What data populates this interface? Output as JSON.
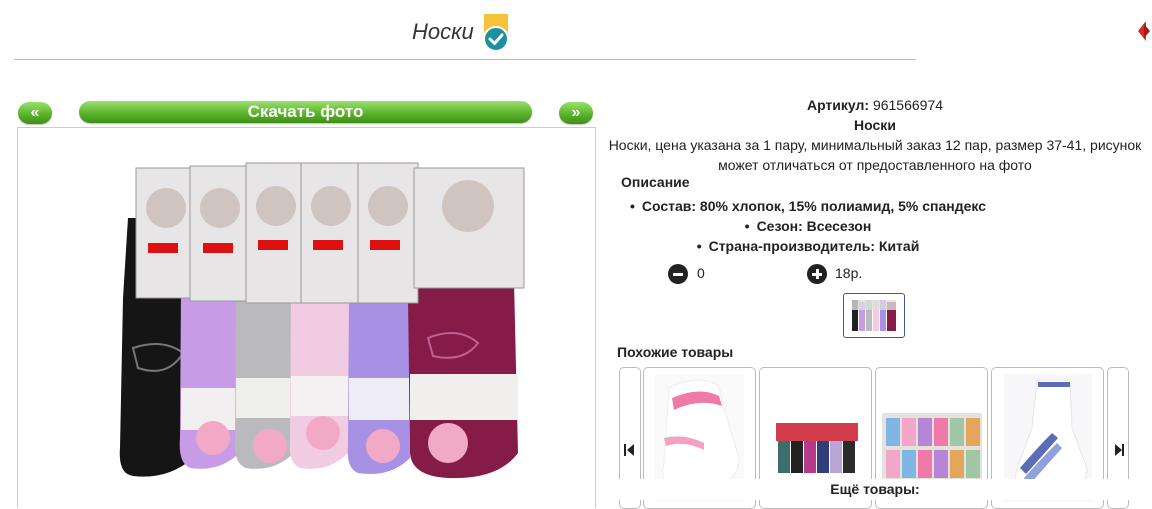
{
  "header": {
    "title": "Носки"
  },
  "gallery": {
    "prev_label": "«",
    "next_label": "»",
    "download_label": "Скачать фото"
  },
  "product": {
    "article_label": "Артикул:",
    "article_value": "961566974",
    "name": "Носки",
    "summary": "Носки, цена указана за 1 пару, минимальный заказ 12 пар, размер 37-41, рисунок может отличаться от предоставленного на фото",
    "description_heading": "Описание",
    "attributes": [
      "Состав: 80% хлопок, 15% полиамид, 5% спандекс",
      "Сезон: Всесезон",
      "Страна-производитель: Китай"
    ],
    "quantity": "0",
    "price": "18р."
  },
  "similar": {
    "heading": "Похожие товары",
    "more_label": "Ещё товары:"
  },
  "icons": {
    "verified": "verified-badge-icon",
    "minus": "minus-circle-icon",
    "plus": "plus-circle-icon",
    "scroll_left": "skip-back-icon",
    "scroll_right": "skip-forward-icon"
  },
  "colors": {
    "accent_green": "#5bb52b",
    "badge_yellow": "#f4c33a",
    "badge_teal": "#1d8fa0",
    "thumb_border": "#3a5a9a"
  }
}
